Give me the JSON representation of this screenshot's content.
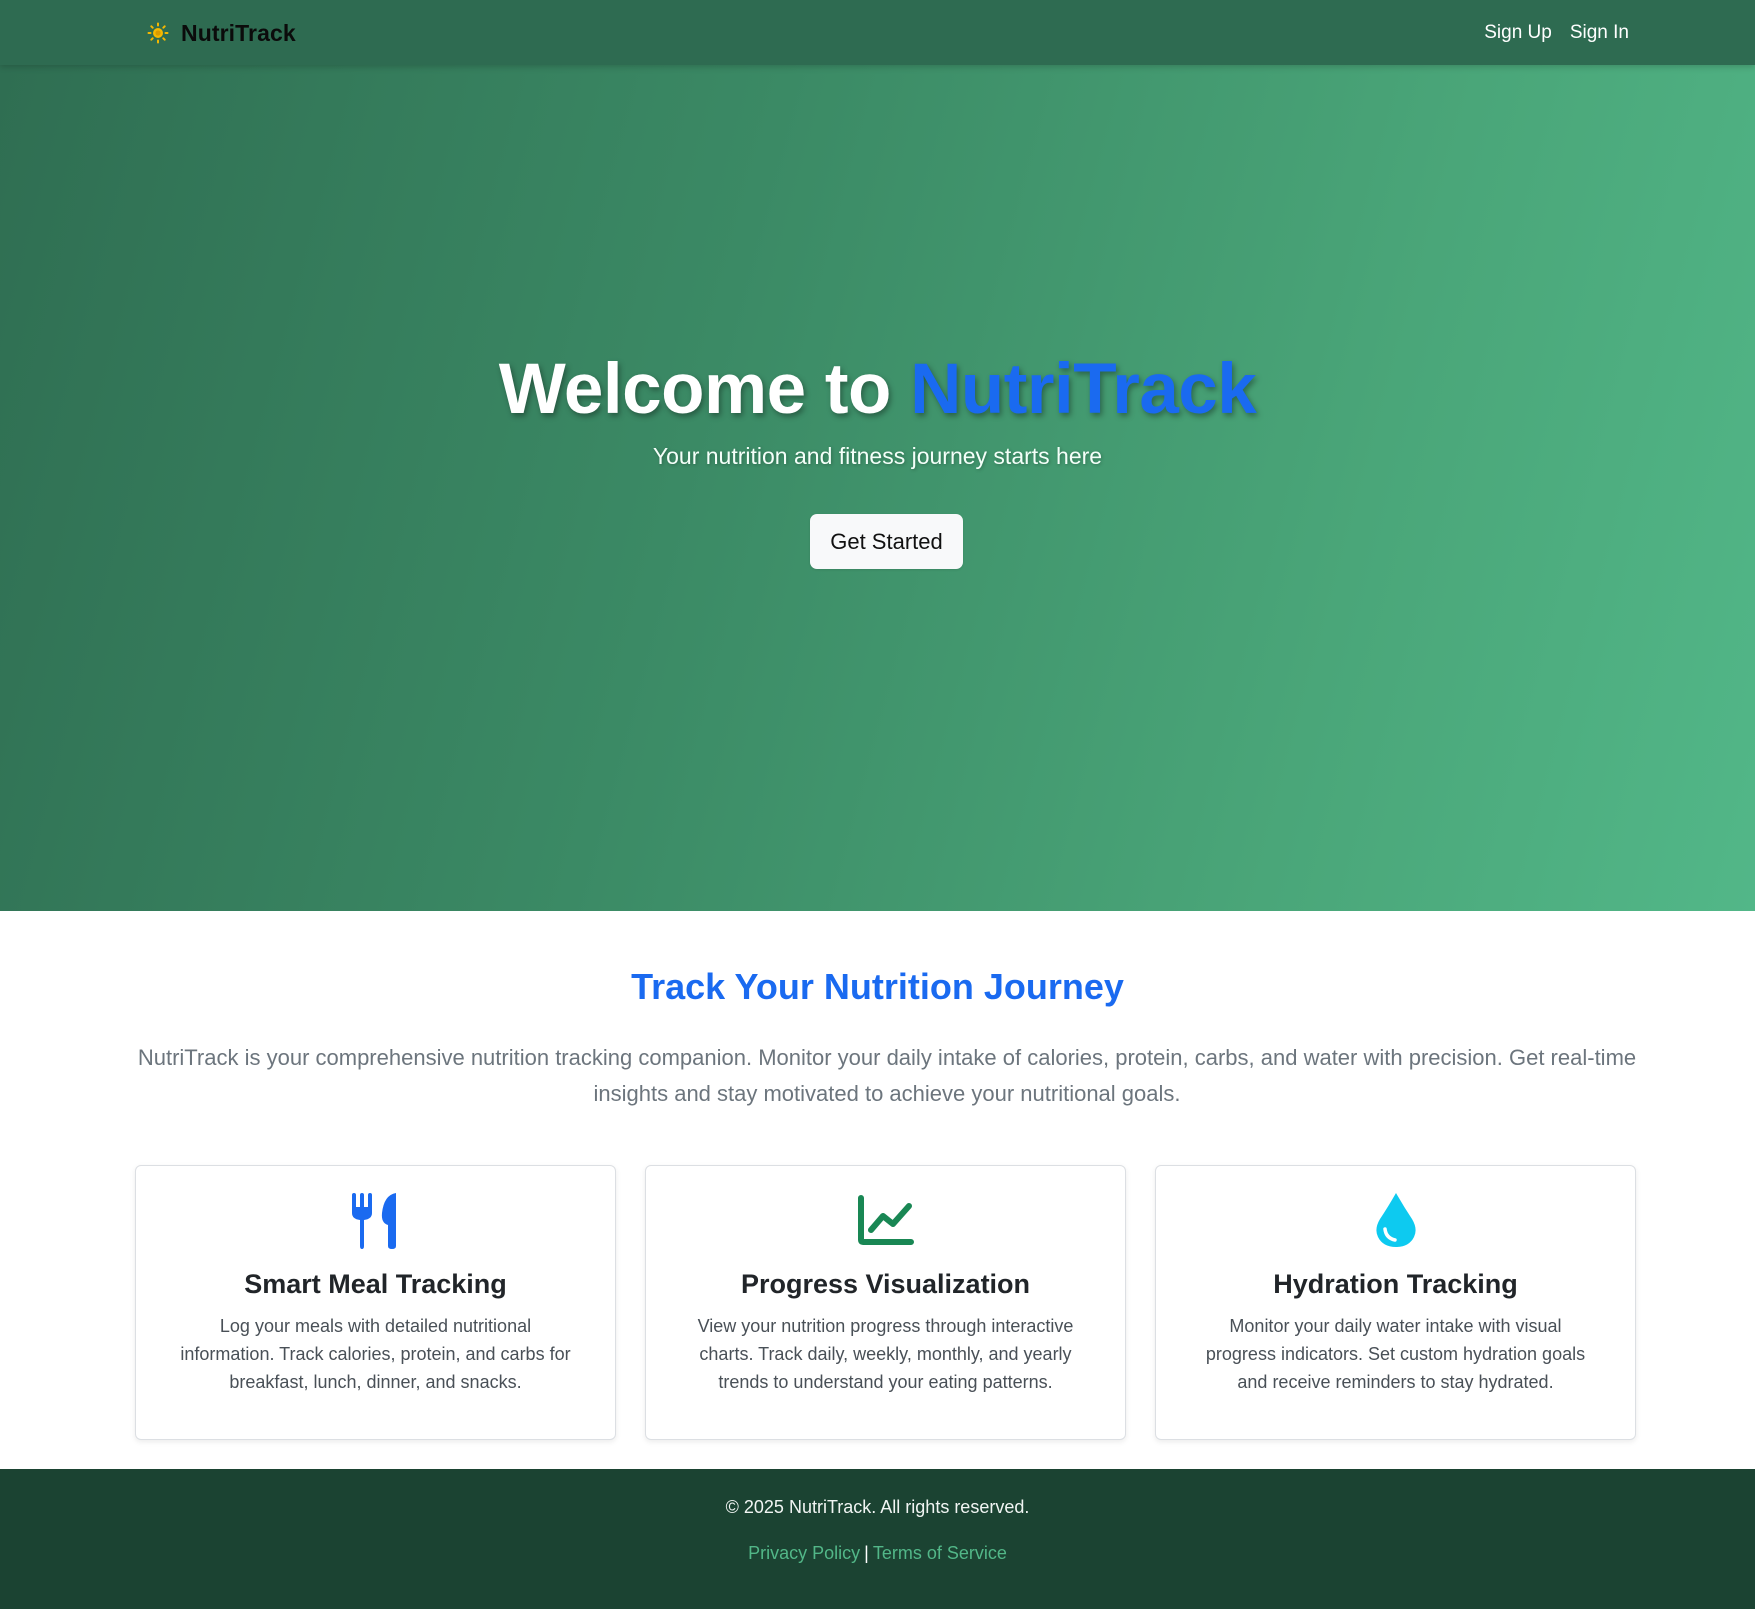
{
  "navbar": {
    "brand": "NutriTrack",
    "brand_icon": "sun-icon",
    "links": [
      "Sign Up",
      "Sign In"
    ]
  },
  "hero": {
    "title_prefix": "Welcome to",
    "title_accent": "NutriTrack",
    "subtitle": "Your nutrition and fitness journey starts here",
    "cta": "Get Started"
  },
  "about": {
    "title": "Track Your Nutrition Journey",
    "description": "NutriTrack is your comprehensive nutrition tracking companion. Monitor your daily intake of calories, protein, carbs, and water with precision. Get real-time insights and stay motivated to achieve your nutritional goals."
  },
  "features": [
    {
      "icon": "utensils-icon",
      "title": "Smart Meal Tracking",
      "text": "Log your meals with detailed nutritional information. Track calories, protein, and carbs for breakfast, lunch, dinner, and snacks."
    },
    {
      "icon": "line-chart-icon",
      "title": "Progress Visualization",
      "text": "View your nutrition progress through interactive charts. Track daily, weekly, monthly, and yearly trends to understand your eating patterns."
    },
    {
      "icon": "water-drop-icon",
      "title": "Hydration Tracking",
      "text": "Monitor your daily water intake with visual progress indicators. Set custom hydration goals and receive reminders to stay hydrated."
    }
  ],
  "footer": {
    "copyright": "© 2025 NutriTrack. All rights reserved.",
    "links": [
      "Privacy Policy",
      "Terms of Service"
    ],
    "separator": "|"
  },
  "colors": {
    "navbar": "#2e6b51",
    "hero_start": "#2f6e52",
    "hero_end": "#52b788",
    "accent_blue": "#1a6af0",
    "footer": "#1b4332",
    "footer_link": "#52b788",
    "brand_icon": "#f5b800",
    "chart_icon": "#198754",
    "drop_icon": "#0dcaf0"
  }
}
